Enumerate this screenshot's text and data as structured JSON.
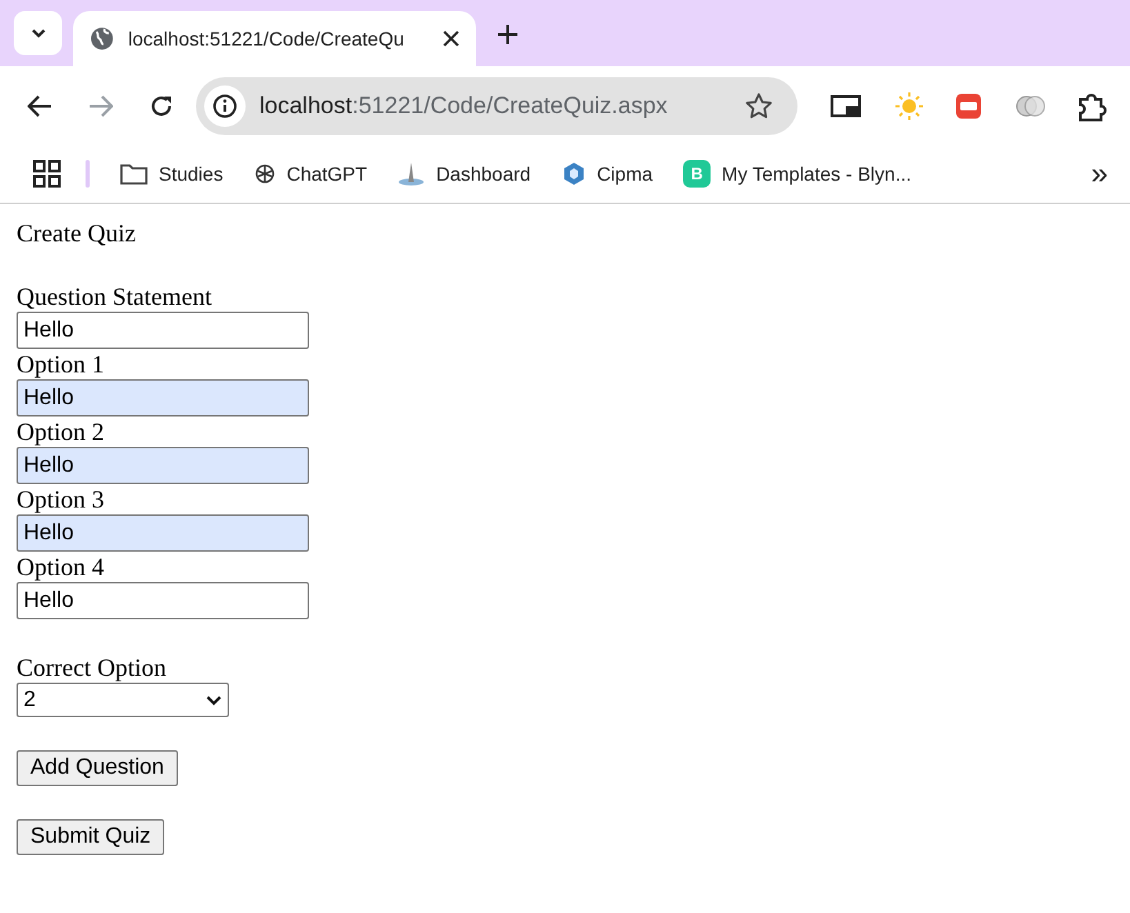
{
  "browser": {
    "tab": {
      "title": "localhost:51221/Code/CreateQu",
      "selected": true
    },
    "address": {
      "host": "localhost",
      "path": ":51221/Code/CreateQuiz.aspx"
    },
    "bookmarks": [
      {
        "kind": "folder",
        "label": "Studies"
      },
      {
        "kind": "knot",
        "label": "ChatGPT"
      },
      {
        "kind": "spike",
        "label": "Dashboard"
      },
      {
        "kind": "cube",
        "label": "Cipma"
      },
      {
        "kind": "letter",
        "badge": "B",
        "label": "My Templates - Blyn..."
      }
    ],
    "more": "»"
  },
  "page": {
    "heading": "Create Quiz",
    "fields": [
      {
        "label": "Question Statement",
        "value": "Hello",
        "autofilled": false
      },
      {
        "label": "Option 1",
        "value": "Hello",
        "autofilled": true
      },
      {
        "label": "Option 2",
        "value": "Hello",
        "autofilled": true
      },
      {
        "label": "Option 3",
        "value": "Hello",
        "autofilled": true
      },
      {
        "label": "Option 4",
        "value": "Hello",
        "autofilled": false
      }
    ],
    "correct_option": {
      "label": "Correct Option",
      "value": "2"
    },
    "buttons": [
      "Add Question",
      "Submit Quiz"
    ]
  }
}
